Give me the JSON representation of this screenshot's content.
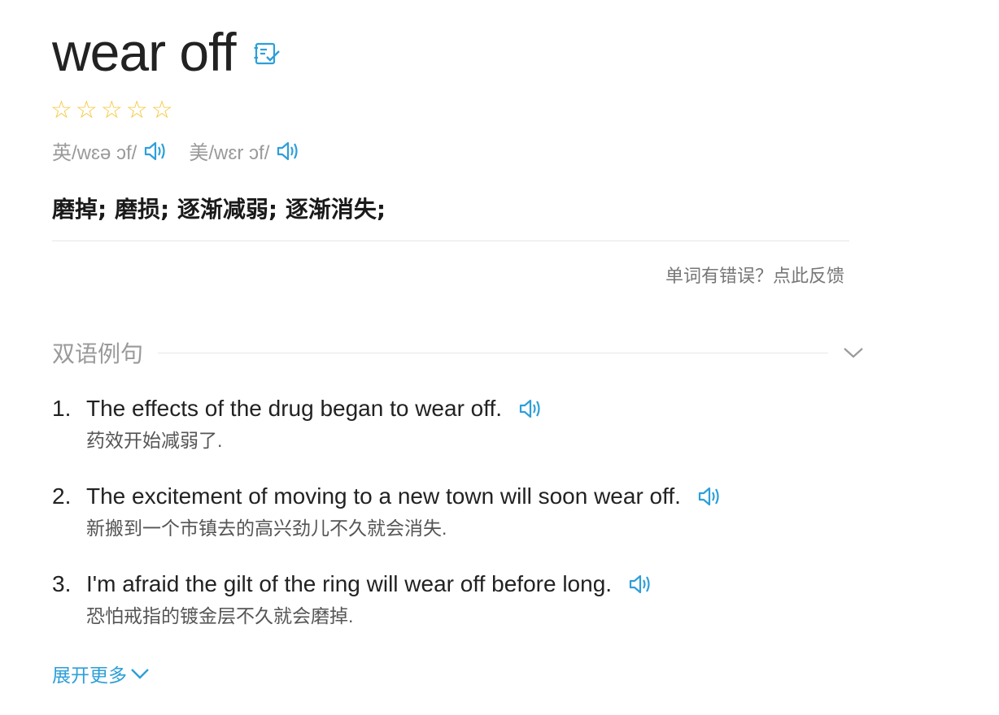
{
  "headword": "wear off",
  "rating": {
    "filled": 0,
    "total": 5
  },
  "phonetics": [
    {
      "label": "英/wɛə ɔf/"
    },
    {
      "label": "美/wɛr ɔf/"
    }
  ],
  "meaning": "磨掉; 磨损; 逐渐减弱; 逐渐消失;",
  "feedback_link": "单词有错误？点此反馈",
  "section": {
    "title": "双语例句"
  },
  "examples": [
    {
      "num": "1.",
      "en": "The effects of the drug began to wear off.",
      "zh": "药效开始减弱了."
    },
    {
      "num": "2.",
      "en": "The excitement of moving to a new town will soon wear off.",
      "zh": "新搬到一个市镇去的高兴劲儿不久就会消失."
    },
    {
      "num": "3.",
      "en": "I'm afraid the gilt of the ring will wear off before long.",
      "zh": "恐怕戒指的镀金层不久就会磨掉."
    }
  ],
  "more_label": "展开更多",
  "colors": {
    "accent": "#2d9fd8",
    "star": "#f5c73a"
  },
  "icons": [
    "wordbook-add-icon",
    "star-outline-icon",
    "speaker-icon",
    "chevron-down-icon"
  ]
}
